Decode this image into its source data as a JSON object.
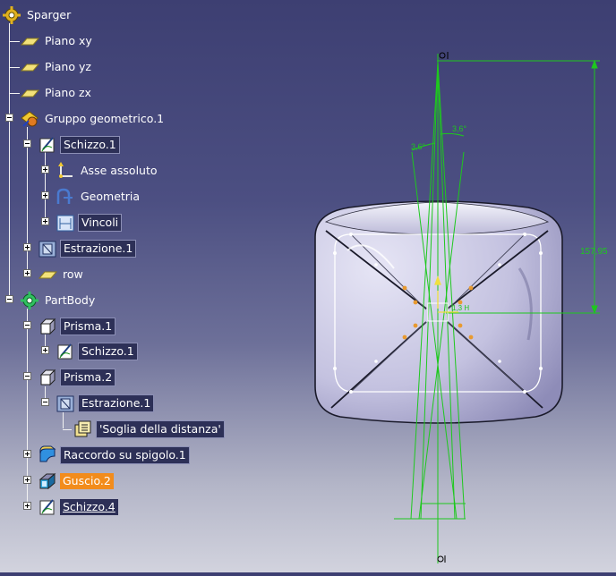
{
  "tree": {
    "items": [
      {
        "id": "root",
        "label": "Sparger",
        "icon": "gear-icon"
      },
      {
        "id": "plane-xy",
        "label": "Piano xy",
        "icon": "plane-icon"
      },
      {
        "id": "plane-yz",
        "label": "Piano yz",
        "icon": "plane-icon"
      },
      {
        "id": "plane-zx",
        "label": "Piano zx",
        "icon": "plane-icon"
      },
      {
        "id": "geo-set",
        "label": "Gruppo geometrico.1",
        "icon": "geometrical-set-icon"
      },
      {
        "id": "sketch1",
        "label": "Schizzo.1",
        "icon": "sketch-icon"
      },
      {
        "id": "abs-axis",
        "label": "Asse assoluto",
        "icon": "axis-icon"
      },
      {
        "id": "geometry",
        "label": "Geometria",
        "icon": "geometry-icon"
      },
      {
        "id": "constraints",
        "label": "Vincoli",
        "icon": "constraints-icon"
      },
      {
        "id": "extract1",
        "label": "Estrazione.1",
        "icon": "extract-icon"
      },
      {
        "id": "row",
        "label": "row",
        "icon": "plane-icon"
      },
      {
        "id": "partbody",
        "label": "PartBody",
        "icon": "body-icon"
      },
      {
        "id": "pad1",
        "label": "Prisma.1",
        "icon": "pad-icon"
      },
      {
        "id": "pad1-sketch",
        "label": "Schizzo.1",
        "icon": "sketch-icon"
      },
      {
        "id": "pad2",
        "label": "Prisma.2",
        "icon": "pad-icon"
      },
      {
        "id": "pad2-extract",
        "label": "Estrazione.1",
        "icon": "extract-icon"
      },
      {
        "id": "threshold",
        "label": "'Soglia della distanza'",
        "icon": "threshold-icon"
      },
      {
        "id": "fillet",
        "label": "Raccordo su spigolo.1",
        "icon": "fillet-icon"
      },
      {
        "id": "shell",
        "label": "Guscio.2",
        "icon": "shell-icon"
      },
      {
        "id": "sketch4",
        "label": "Schizzo.4",
        "icon": "sketch-icon"
      }
    ]
  },
  "viewer": {
    "dim_vertical": "157,95",
    "angle_left": "3,6°",
    "angle_right": "3,6°",
    "small_label": "1,3 H"
  },
  "colors": {
    "background_top": "#3d3f72",
    "background_bottom": "#d2d3de",
    "tree_line": "#f2f2f2",
    "highlight": "#f28c1c",
    "sketch_green": "#1ec81e",
    "part_fill": "#c9c8e6"
  }
}
